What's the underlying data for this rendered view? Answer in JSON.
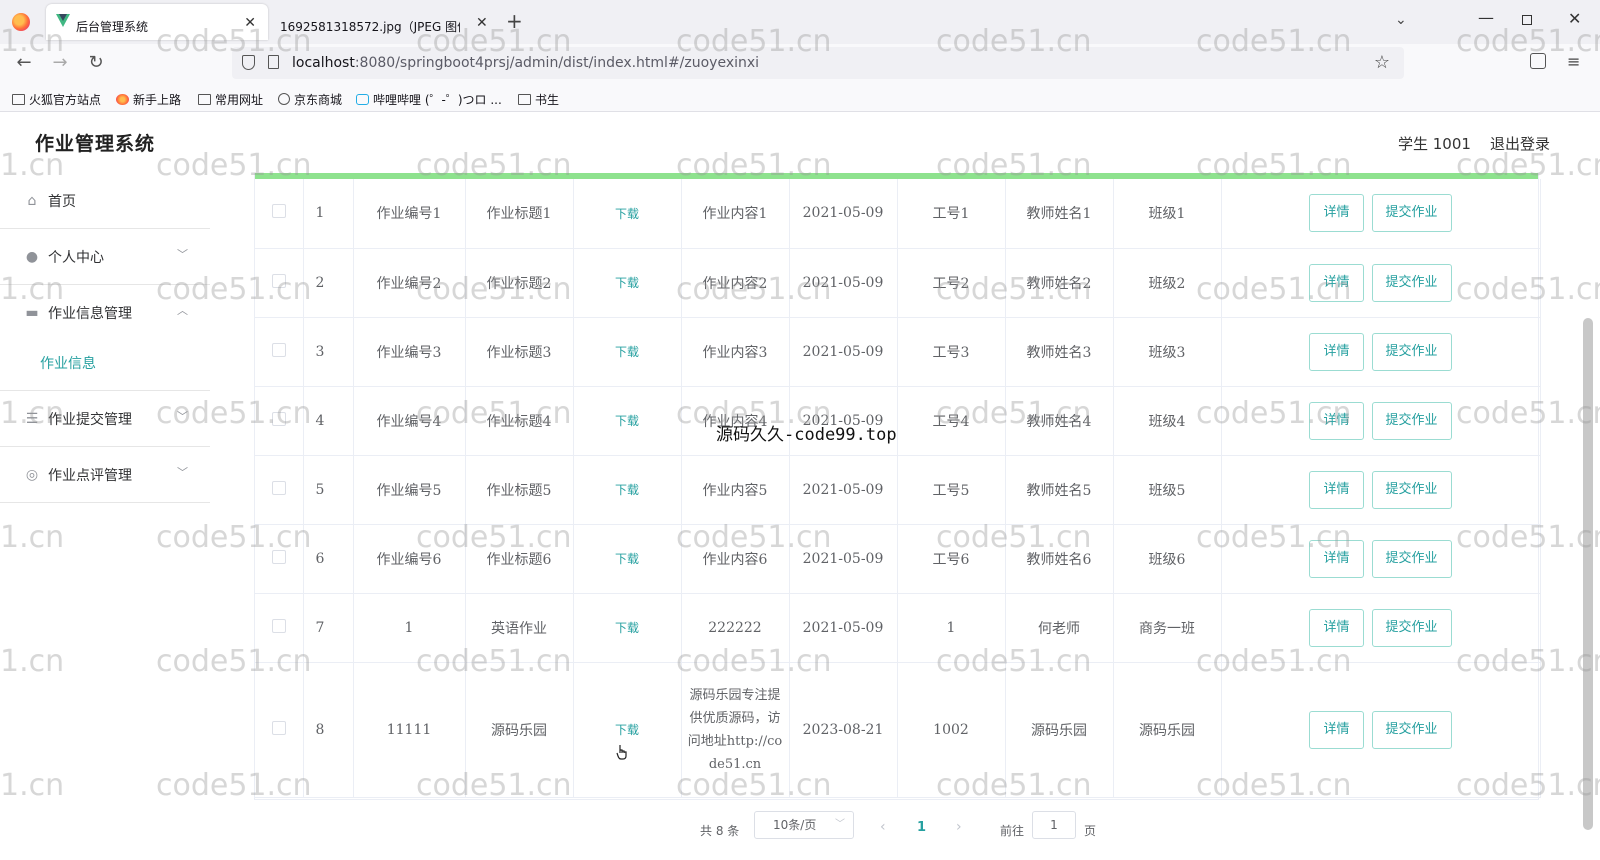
{
  "browser": {
    "active_tab_title": "后台管理系统",
    "second_tab_title": "1692581318572.jpg（JPEG 图像,",
    "url_host": "localhost",
    "url_rest": ":8080/springboot4prsj/admin/dist/index.html#/zuoyexinxi",
    "bookmarks": [
      "火狐官方站点",
      "新手上路",
      "常用网址",
      "京东商城",
      "哔哩哔哩 (゜-゜)つロ ...",
      "书生"
    ]
  },
  "header": {
    "title": "作业管理系统",
    "user": "学生 1001",
    "logout": "退出登录"
  },
  "sidebar": {
    "home": "首页",
    "personal": "个人中心",
    "homework_mgmt": "作业信息管理",
    "homework_info": "作业信息",
    "submit_mgmt": "作业提交管理",
    "review_mgmt": "作业点评管理"
  },
  "table": {
    "download_label": "下载",
    "detail_label": "详情",
    "submit_label": "提交作业",
    "rows": [
      {
        "idx": "1",
        "no": "作业编号1",
        "title": "作业标题1",
        "content": "作业内容1",
        "date": "2021-05-09",
        "job": "工号1",
        "teacher": "教师姓名1",
        "cls": "班级1"
      },
      {
        "idx": "2",
        "no": "作业编号2",
        "title": "作业标题2",
        "content": "作业内容2",
        "date": "2021-05-09",
        "job": "工号2",
        "teacher": "教师姓名2",
        "cls": "班级2"
      },
      {
        "idx": "3",
        "no": "作业编号3",
        "title": "作业标题3",
        "content": "作业内容3",
        "date": "2021-05-09",
        "job": "工号3",
        "teacher": "教师姓名3",
        "cls": "班级3"
      },
      {
        "idx": "4",
        "no": "作业编号4",
        "title": "作业标题4",
        "content": "作业内容4",
        "date": "2021-05-09",
        "job": "工号4",
        "teacher": "教师姓名4",
        "cls": "班级4"
      },
      {
        "idx": "5",
        "no": "作业编号5",
        "title": "作业标题5",
        "content": "作业内容5",
        "date": "2021-05-09",
        "job": "工号5",
        "teacher": "教师姓名5",
        "cls": "班级5"
      },
      {
        "idx": "6",
        "no": "作业编号6",
        "title": "作业标题6",
        "content": "作业内容6",
        "date": "2021-05-09",
        "job": "工号6",
        "teacher": "教师姓名6",
        "cls": "班级6"
      },
      {
        "idx": "7",
        "no": "1",
        "title": "英语作业",
        "content": "222222",
        "date": "2021-05-09",
        "job": "1",
        "teacher": "何老师",
        "cls": "商务一班"
      },
      {
        "idx": "8",
        "no": "11111",
        "title": "源码乐园",
        "content": "源码乐园专注提供优质源码，访问地址http://code51.cn",
        "date": "2023-08-21",
        "job": "1002",
        "teacher": "源码乐园",
        "cls": "源码乐园"
      }
    ]
  },
  "pagination": {
    "total": "共 8 条",
    "page_size": "10条/页",
    "current": "1",
    "goto": "前往",
    "goto_value": "1",
    "page_unit": "页"
  },
  "overlay_text": "源码久久-code99.top",
  "watermark": "code51.cn",
  "watermark_fragment": "1.cn",
  "colors": {
    "accent": "#26a0a0",
    "top_bar": "#8ee28e"
  }
}
